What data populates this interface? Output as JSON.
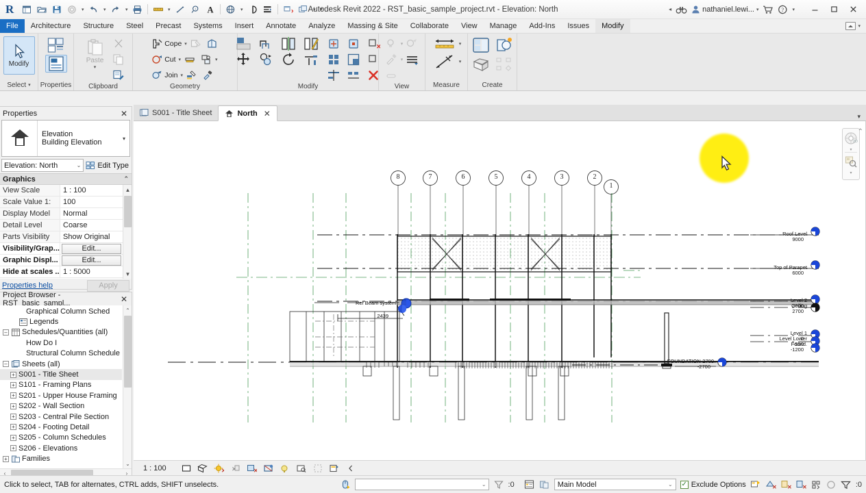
{
  "app": {
    "title": "Autodesk Revit 2022 - RST_basic_sample_project.rvt - Elevation: North",
    "logo": "R"
  },
  "quick_access": {
    "items": [
      {
        "name": "new-project-icon",
        "label": "New"
      },
      {
        "name": "open-icon",
        "label": "Open"
      },
      {
        "name": "save-icon",
        "label": "Save"
      },
      {
        "name": "save-as-icon",
        "label": "Save As"
      },
      {
        "name": "undo-icon",
        "label": "Undo"
      },
      {
        "name": "redo-icon",
        "label": "Redo"
      },
      {
        "name": "print-icon",
        "label": "Print"
      },
      {
        "name": "measure-icon",
        "label": "Measure"
      },
      {
        "name": "aligned-dimension-icon",
        "label": "Aligned Dimension"
      },
      {
        "name": "tag-icon",
        "label": "Tag by Category"
      },
      {
        "name": "text-icon",
        "label": "Text"
      },
      {
        "name": "default-3d-view-icon",
        "label": "Default 3D View"
      },
      {
        "name": "section-icon",
        "label": "Section"
      },
      {
        "name": "thin-lines-icon",
        "label": "Thin Lines"
      },
      {
        "name": "close-hidden-windows-icon",
        "label": "Close Inactive Views"
      },
      {
        "name": "switch-windows-icon",
        "label": "Switch Windows"
      },
      {
        "name": "customize-qat-icon",
        "label": "Customize Quick Access Toolbar"
      }
    ]
  },
  "account": {
    "search_icon": "search-icon",
    "infocenter_icon": "binoculars-icon",
    "user_name": "nathaniel.lewi...",
    "cart_icon": "shopping-cart-icon",
    "help_icon": "help-icon"
  },
  "window_controls": {
    "minimize": "–",
    "maximize": "☐",
    "close": "✕"
  },
  "ribbon": {
    "tabs": [
      {
        "label": "File",
        "state": "file"
      },
      {
        "label": "Architecture",
        "state": "normal"
      },
      {
        "label": "Structure",
        "state": "normal"
      },
      {
        "label": "Steel",
        "state": "normal"
      },
      {
        "label": "Precast",
        "state": "normal"
      },
      {
        "label": "Systems",
        "state": "normal"
      },
      {
        "label": "Insert",
        "state": "normal"
      },
      {
        "label": "Annotate",
        "state": "normal"
      },
      {
        "label": "Analyze",
        "state": "normal"
      },
      {
        "label": "Massing & Site",
        "state": "normal"
      },
      {
        "label": "Collaborate",
        "state": "normal"
      },
      {
        "label": "View",
        "state": "normal"
      },
      {
        "label": "Manage",
        "state": "normal"
      },
      {
        "label": "Add-Ins",
        "state": "normal"
      },
      {
        "label": "Issues",
        "state": "normal"
      },
      {
        "label": "Modify",
        "state": "active"
      }
    ],
    "panels": [
      {
        "name": "select",
        "label": "Select",
        "has_dropdown": true,
        "big_button": {
          "label": "Modify",
          "icon": "arrow-cursor-icon",
          "selected": true
        }
      },
      {
        "name": "properties",
        "label": "Properties",
        "buttons": [
          {
            "label": "",
            "icon": "properties-type-icon"
          },
          {
            "label": "",
            "icon": "properties-panel-icon",
            "selected": true
          }
        ]
      },
      {
        "name": "clipboard",
        "label": "Clipboard",
        "big_button": {
          "label": "Paste",
          "icon": "paste-icon",
          "disabled": true
        },
        "buttons": [
          {
            "label": "",
            "icon": "cut-scissors-icon",
            "disabled": true
          },
          {
            "label": "",
            "icon": "copy-icon",
            "disabled": true
          },
          {
            "label": "",
            "icon": "match-type-icon"
          }
        ]
      },
      {
        "name": "geometry",
        "label": "Geometry",
        "buttons": [
          {
            "label": "Cope",
            "icon": "cope-icon",
            "has_dropdown": true
          },
          {
            "label": "Cut",
            "icon": "cut-geometry-icon",
            "has_dropdown": true
          },
          {
            "label": "Join",
            "icon": "join-geometry-icon",
            "has_dropdown": true
          },
          {
            "label": "",
            "icon": "demolish-icon",
            "disabled": true
          },
          {
            "label": "",
            "icon": "split-face-icon"
          },
          {
            "label": "",
            "icon": "wall-joins-icon"
          },
          {
            "label": "",
            "icon": "beam-joins-icon",
            "has_dropdown": true
          },
          {
            "label": "",
            "icon": "paint-icon"
          }
        ]
      },
      {
        "name": "modify",
        "label": "Modify",
        "buttons": [
          {
            "label": "",
            "icon": "align-icon"
          },
          {
            "label": "",
            "icon": "offset-icon"
          },
          {
            "label": "",
            "icon": "mirror-pick-axis-icon"
          },
          {
            "label": "",
            "icon": "mirror-draw-axis-icon"
          },
          {
            "label": "",
            "icon": "move-icon"
          },
          {
            "label": "",
            "icon": "copy-element-icon"
          },
          {
            "label": "",
            "icon": "rotate-icon"
          },
          {
            "label": "",
            "icon": "trim-extend-icon"
          },
          {
            "label": "",
            "icon": "pin-icon"
          },
          {
            "label": "",
            "icon": "unpin-icon"
          },
          {
            "label": "",
            "icon": "array-icon"
          },
          {
            "label": "",
            "icon": "scale-icon"
          },
          {
            "label": "",
            "icon": "split-element-icon"
          },
          {
            "label": "",
            "icon": "split-with-gap-icon"
          },
          {
            "label": "",
            "icon": "delete-icon"
          }
        ]
      },
      {
        "name": "view",
        "label": "View",
        "buttons": [
          {
            "label": "",
            "icon": "hide-element-icon",
            "disabled": true,
            "has_dropdown": true
          },
          {
            "label": "",
            "icon": "override-graphics-icon",
            "disabled": true
          },
          {
            "label": "",
            "icon": "linework-icon",
            "disabled": true,
            "has_dropdown": true
          },
          {
            "label": "",
            "icon": "show-hidden-icon",
            "disabled": true
          },
          {
            "label": "",
            "icon": "reveal-constraints-icon",
            "disabled": true
          }
        ]
      },
      {
        "name": "measure",
        "label": "Measure",
        "buttons": [
          {
            "label": "",
            "icon": "measure-between-references-icon",
            "has_dropdown": true
          },
          {
            "label": "",
            "icon": "measure-along-element-icon",
            "has_dropdown": true
          }
        ]
      },
      {
        "name": "create",
        "label": "Create",
        "buttons": [
          {
            "label": "",
            "icon": "create-similar-icon"
          },
          {
            "label": "",
            "icon": "create-part-icon"
          },
          {
            "label": "",
            "icon": "create-group-icon"
          },
          {
            "label": "",
            "icon": "create-assembly-icon",
            "disabled": true
          }
        ]
      }
    ]
  },
  "properties_palette": {
    "title": "Properties",
    "close_label": "✕",
    "type_family": "Elevation",
    "type_name": "Building Elevation",
    "thumbnail_icon": "elevation-house-icon",
    "instance_selector": "Elevation: North",
    "edit_type_label": "Edit Type",
    "edit_type_icon": "edit-type-icon",
    "group_header": "Graphics",
    "rows": [
      {
        "key": "View Scale",
        "value": "1 : 100",
        "type": "text",
        "bold": false
      },
      {
        "key": "Scale Value    1:",
        "value": "100",
        "type": "text",
        "bold": false
      },
      {
        "key": "Display Model",
        "value": "Normal",
        "type": "text",
        "bold": false
      },
      {
        "key": "Detail Level",
        "value": "Coarse",
        "type": "text",
        "bold": false
      },
      {
        "key": "Parts Visibility",
        "value": "Show Original",
        "type": "text",
        "bold": false
      },
      {
        "key": "Visibility/Grap...",
        "value": "Edit...",
        "type": "button",
        "bold": true
      },
      {
        "key": "Graphic Displ...",
        "value": "Edit...",
        "type": "button",
        "bold": true
      },
      {
        "key": "Hide at scales ...",
        "value": "1 : 5000",
        "type": "text",
        "bold": true
      }
    ],
    "help_link": "Properties help",
    "apply_label": "Apply"
  },
  "project_browser": {
    "title": "Project Browser - RST_basic_sampl...",
    "close_label": "✕",
    "nodes": [
      {
        "label": "Graphical Column Sched",
        "indent": 2,
        "expander": "none",
        "icon": "",
        "selected": false
      },
      {
        "label": "Legends",
        "indent": 1,
        "expander": "none",
        "icon": "legend-icon",
        "selected": false
      },
      {
        "label": "Schedules/Quantities (all)",
        "indent": 0,
        "expander": "minus",
        "icon": "schedule-icon",
        "selected": false
      },
      {
        "label": "How Do I",
        "indent": 2,
        "expander": "none",
        "icon": "",
        "selected": false
      },
      {
        "label": "Structural Column Schedule",
        "indent": 2,
        "expander": "none",
        "icon": "",
        "selected": false
      },
      {
        "label": "Sheets (all)",
        "indent": 0,
        "expander": "minus",
        "icon": "sheets-icon",
        "selected": false
      },
      {
        "label": "S001 - Title Sheet",
        "indent": 1,
        "expander": "plus",
        "icon": "",
        "selected": true
      },
      {
        "label": "S101 - Framing Plans",
        "indent": 1,
        "expander": "plus",
        "icon": "",
        "selected": false
      },
      {
        "label": "S201 - Upper House Framing",
        "indent": 1,
        "expander": "plus",
        "icon": "",
        "selected": false
      },
      {
        "label": "S202 - Wall Section",
        "indent": 1,
        "expander": "plus",
        "icon": "",
        "selected": false
      },
      {
        "label": "S203 - Central Pile Section",
        "indent": 1,
        "expander": "plus",
        "icon": "",
        "selected": false
      },
      {
        "label": "S204 - Footing Detail",
        "indent": 1,
        "expander": "plus",
        "icon": "",
        "selected": false
      },
      {
        "label": "S205 - Column Schedules",
        "indent": 1,
        "expander": "plus",
        "icon": "",
        "selected": false
      },
      {
        "label": "S206 - Elevations",
        "indent": 1,
        "expander": "plus",
        "icon": "",
        "selected": false
      },
      {
        "label": "Families",
        "indent": 0,
        "expander": "plus",
        "icon": "families-icon",
        "selected": false
      }
    ]
  },
  "view_tabs": [
    {
      "label": "S001 - Title Sheet",
      "icon": "sheet-icon",
      "active": false,
      "closable": false
    },
    {
      "label": "North",
      "icon": "elevation-house-icon",
      "active": true,
      "closable": true,
      "close_label": "✕"
    }
  ],
  "drawing": {
    "grid_bubbles": [
      "8",
      "7",
      "6",
      "5",
      "4",
      "3",
      "2",
      "1"
    ],
    "levels": [
      {
        "name": "Roof Level",
        "elevation": "9000"
      },
      {
        "name": "Top of Parapet",
        "elevation": "6000"
      },
      {
        "name": "Level 2",
        "elevation": "3000"
      },
      {
        "name": "Ceiling",
        "elevation": "2700"
      },
      {
        "name": "Level 1",
        "elevation": "0"
      },
      {
        "name": "Level Lower",
        "elevation": "-550"
      },
      {
        "name": "Found.",
        "elevation": "-1200"
      },
      {
        "name": "FOUNDATION-2700",
        "elevation": "-2700"
      }
    ],
    "annotations": [
      {
        "text": "Ref Beam system",
        "sub": "2439"
      }
    ],
    "navbar": {
      "steering_wheel_icon": "steering-wheel-icon",
      "zoom_icon": "zoom-region-icon"
    },
    "cursor_highlight_color": "#ffed00"
  },
  "view_control_bar": {
    "scale": "1 : 100",
    "buttons": [
      {
        "name": "detail-level-icon"
      },
      {
        "name": "visual-style-icon"
      },
      {
        "name": "sun-path-icon"
      },
      {
        "name": "shadows-icon"
      },
      {
        "name": "render-icon"
      },
      {
        "name": "crop-view-icon"
      },
      {
        "name": "show-crop-region-icon"
      },
      {
        "name": "lock-3d-view-icon"
      },
      {
        "name": "temporary-hide-isolate-icon"
      },
      {
        "name": "reveal-hidden-elements-icon"
      },
      {
        "name": "analytical-model-icon"
      },
      {
        "name": "constraints-icon"
      },
      {
        "name": "expand-arrow-icon"
      }
    ]
  },
  "status_bar": {
    "message": "Click to select, TAB for alternates, CTRL adds, SHIFT unselects.",
    "press_pick_icon": "press-and-drag-icon",
    "filter_input_value": "",
    "count_label": ":0",
    "worksets_icon": "worksets-icon",
    "design_options_icon": "design-options-icon",
    "design_option_value": "Main Model",
    "exclude_options_label": "Exclude Options",
    "exclude_options_checked": true,
    "right_icons": [
      {
        "name": "editable-only-icon"
      },
      {
        "name": "active-workset-icon"
      },
      {
        "name": "select-links-icon"
      },
      {
        "name": "select-underlay-icon"
      },
      {
        "name": "select-pinned-icon"
      },
      {
        "name": "select-face-icon"
      },
      {
        "name": "drag-elements-icon"
      },
      {
        "name": "filter-icon"
      }
    ],
    "filter_count": ":0"
  }
}
